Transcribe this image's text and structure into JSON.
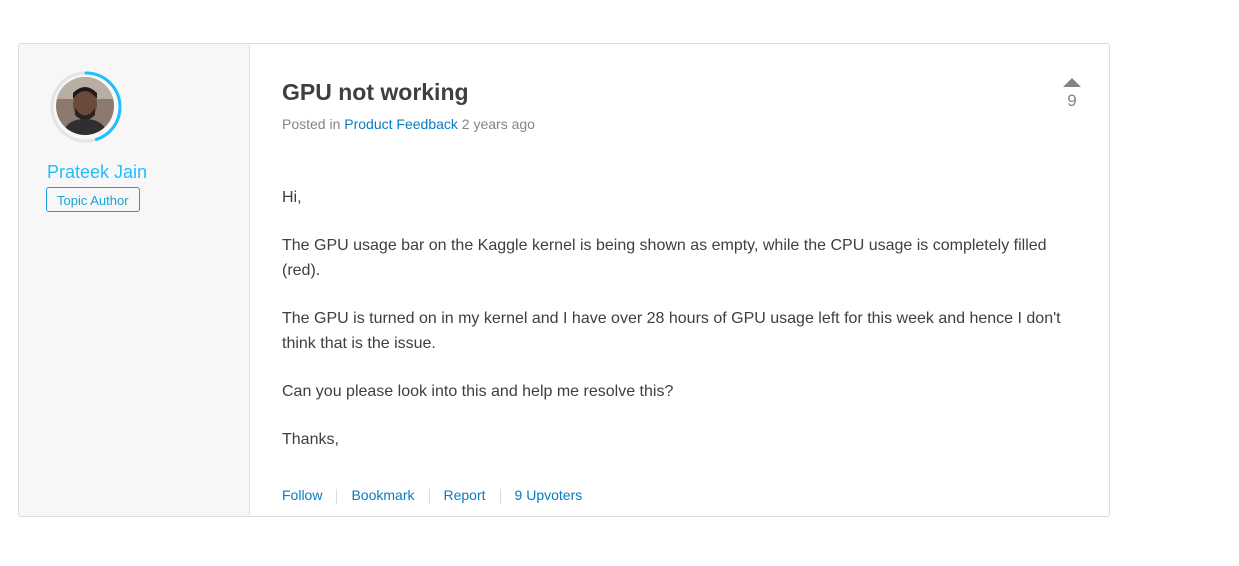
{
  "post": {
    "title": "GPU not working",
    "meta_prefix": "Posted in",
    "category": "Product Feedback",
    "time_ago": "2 years ago",
    "vote_count": "9",
    "paragraphs": [
      "Hi,",
      "The GPU usage bar on the Kaggle kernel is being shown as empty, while the CPU usage is completely filled (red).",
      "The GPU is turned on in my kernel and I have over 28 hours of GPU usage left for this week and hence I don't think that is the issue.",
      "Can you please look into this and help me resolve this?",
      "Thanks,"
    ],
    "actions": {
      "follow": "Follow",
      "bookmark": "Bookmark",
      "report": "Report",
      "upvoters": "9 Upvoters"
    }
  },
  "author": {
    "name": "Prateek Jain",
    "badge": "Topic Author",
    "ring_color": "#20beff",
    "progress_fraction": 0.45
  }
}
